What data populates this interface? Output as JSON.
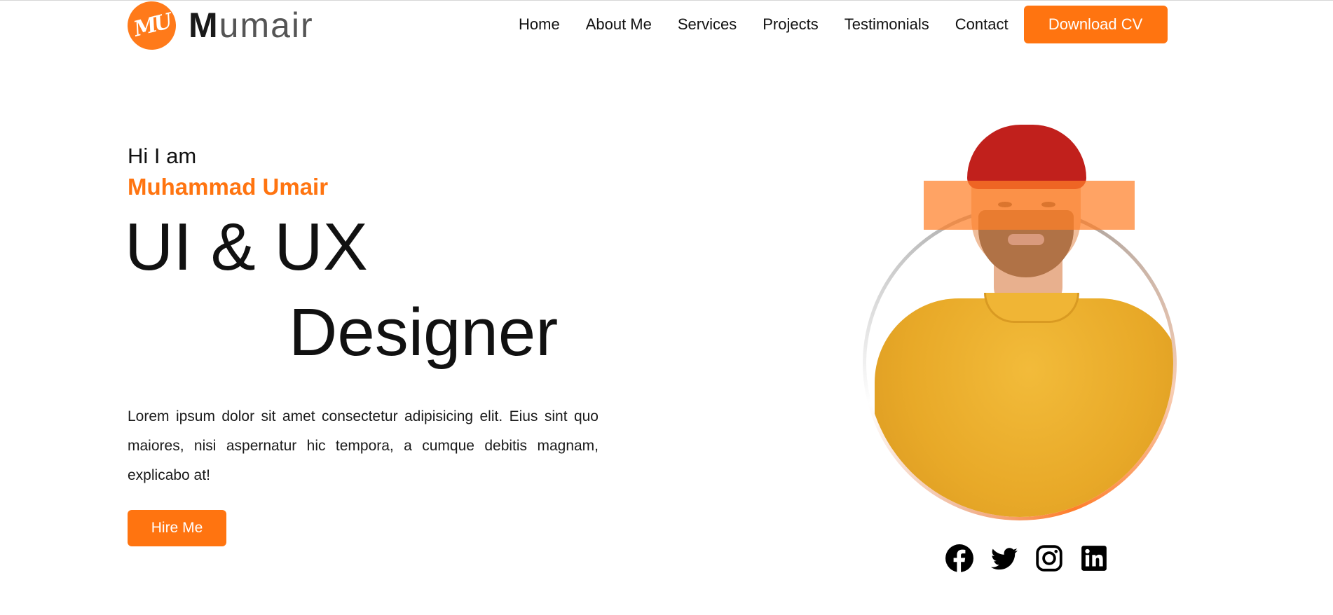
{
  "brand": {
    "logo_mark": "MU",
    "name_bold": "M",
    "name_rest": "umair"
  },
  "nav": {
    "items": [
      {
        "label": "Home"
      },
      {
        "label": "About Me"
      },
      {
        "label": "Services"
      },
      {
        "label": "Projects"
      },
      {
        "label": "Testimonials"
      },
      {
        "label": "Contact"
      }
    ],
    "cta_label": "Download CV"
  },
  "hero": {
    "greeting": "Hi I am",
    "name": "Muhammad Umair",
    "title_line1": "UI & UX",
    "title_line2": "Designer",
    "description": "Lorem ipsum dolor sit amet consectetur adipisicing elit. Eius sint quo maiores, nisi aspernatur hic tempora, a cumque debitis magnam, explicabo at!",
    "cta_label": "Hire Me"
  },
  "social": [
    "facebook-icon",
    "twitter-icon",
    "instagram-icon",
    "linkedin-icon"
  ],
  "colors": {
    "accent": "#ff7410",
    "text": "#111111",
    "background": "#ffffff"
  }
}
